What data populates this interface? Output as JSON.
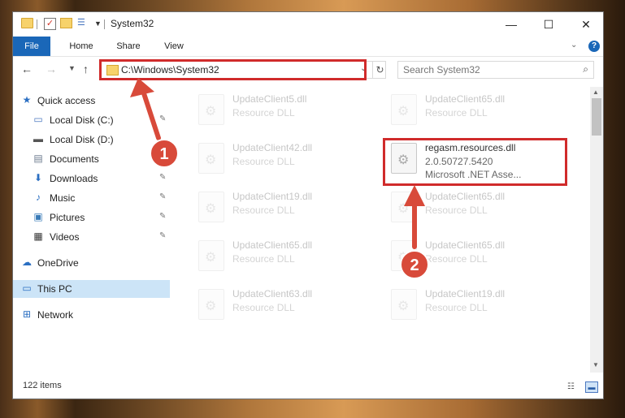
{
  "window": {
    "title": "System32",
    "controls": {
      "minimize": "—",
      "maximize": "☐",
      "close": "✕"
    }
  },
  "ribbon": {
    "tabs": [
      {
        "label": "File"
      },
      {
        "label": "Home"
      },
      {
        "label": "Share"
      },
      {
        "label": "View"
      }
    ]
  },
  "address": {
    "path": "C:\\Windows\\System32"
  },
  "search": {
    "placeholder": "Search System32"
  },
  "sidebar": {
    "quick_access": "Quick access",
    "items": [
      {
        "label": "Local Disk (C:)",
        "icon": "drive-icon"
      },
      {
        "label": "Local Disk (D:)",
        "icon": "drive-icon"
      },
      {
        "label": "Documents",
        "icon": "documents-icon"
      },
      {
        "label": "Downloads",
        "icon": "downloads-icon"
      },
      {
        "label": "Music",
        "icon": "music-icon"
      },
      {
        "label": "Pictures",
        "icon": "pictures-icon"
      },
      {
        "label": "Videos",
        "icon": "videos-icon"
      }
    ],
    "onedrive": "OneDrive",
    "this_pc": "This PC",
    "network": "Network"
  },
  "files": [
    {
      "name": "UpdateClient5.dll",
      "type": "Resource DLL"
    },
    {
      "name": "UpdateClient65.dll",
      "type": "Resource DLL"
    },
    {
      "name": "UpdateClient42.dll",
      "type": "Resource DLL"
    },
    {
      "name": "regasm.resources.dll",
      "version": "2.0.50727.5420",
      "type": "Microsoft .NET Asse..."
    },
    {
      "name": "UpdateClient19.dll",
      "type": "Resource DLL"
    },
    {
      "name": "UpdateClient65.dll",
      "type": "Resource DLL"
    },
    {
      "name": "UpdateClient65.dll",
      "type": "Resource DLL"
    },
    {
      "name": "UpdateClient65.dll",
      "type": "Resource DLL"
    },
    {
      "name": "UpdateClient63.dll",
      "type": "Resource DLL"
    },
    {
      "name": "UpdateClient19.dll",
      "type": "Resource DLL"
    }
  ],
  "status": {
    "item_count": "122 items"
  },
  "annotations": {
    "step1": "1",
    "step2": "2",
    "color": "#d84a3a"
  }
}
